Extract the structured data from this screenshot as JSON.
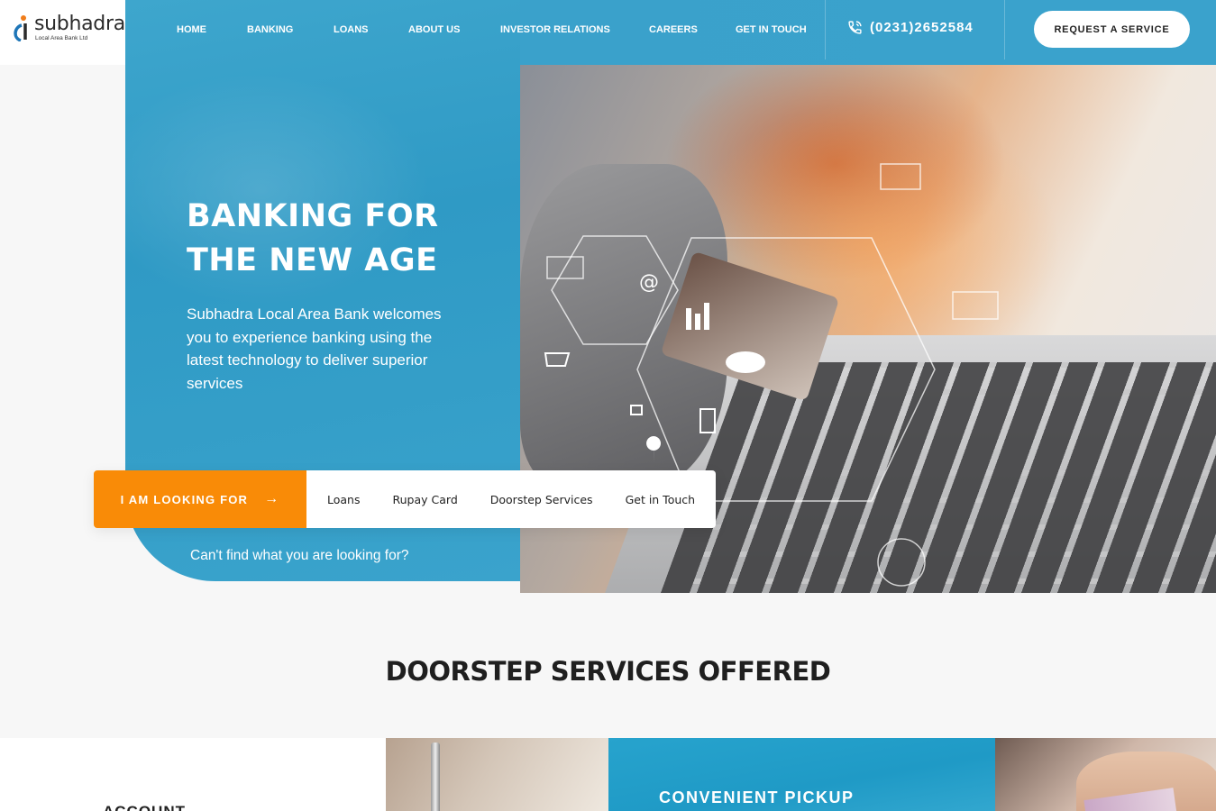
{
  "logo": {
    "name": "subhadra",
    "subtitle": "Local Area Bank Ltd"
  },
  "nav": {
    "items": [
      "HOME",
      "BANKING",
      "LOANS",
      "ABOUT US",
      "INVESTOR RELATIONS",
      "CAREERS",
      "GET IN TOUCH"
    ],
    "phone": "(0231)2652584",
    "phone_icon": "phone-icon",
    "request_button": "REQUEST A SERVICE"
  },
  "hero": {
    "title_line1": "BANKING FOR",
    "title_line2": "THE NEW AGE",
    "description": "Subhadra Local Area Bank welcomes you to experience banking using the latest technology to deliver superior services"
  },
  "looking_for": {
    "button": "I AM LOOKING FOR",
    "arrow_icon": "arrow-right-icon",
    "links": [
      "Loans",
      "Rupay Card",
      "Doorstep Services",
      "Get in Touch"
    ],
    "cant_find": "Can't find what you are looking for?"
  },
  "doorstep": {
    "title": "DOORSTEP SERVICES OFFERED",
    "card1_title": "ACCOUNT",
    "card2_title": "CONVENIENT PICKUP"
  },
  "colors": {
    "brand_blue": "#3aa2cc",
    "accent_orange": "#f98b07",
    "logo_orange": "#f07d1a",
    "logo_blue": "#1f76b8"
  }
}
